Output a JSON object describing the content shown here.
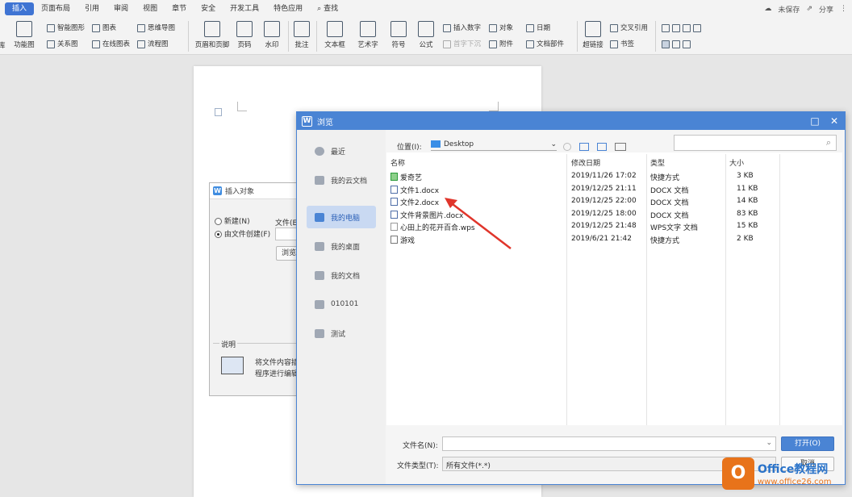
{
  "menubar": {
    "tabs": [
      "插入",
      "页面布局",
      "引用",
      "审阅",
      "视图",
      "章节",
      "安全",
      "开发工具",
      "特色应用",
      "查找"
    ],
    "right": {
      "unsaved": "未保存",
      "share": "分享"
    }
  },
  "ribbon": {
    "left_cut": [
      "库",
      "功能图"
    ],
    "col2": [
      "智能图形",
      "关系图"
    ],
    "col3": [
      "图表",
      "在线图表"
    ],
    "col4": [
      "思维导图",
      "流程图"
    ],
    "big": [
      "页眉和页脚",
      "页码",
      "水印",
      "批注",
      "文本框",
      "艺术字",
      "符号",
      "公式"
    ],
    "col5": [
      "插入数字",
      "首字下沉"
    ],
    "col6": [
      "对象",
      "附件"
    ],
    "col7": [
      "日期",
      "文档部件"
    ],
    "big2": [
      "超链接"
    ],
    "col8": [
      "交叉引用",
      "书签"
    ]
  },
  "insert_dialog": {
    "title": "插入对象",
    "radio_new": "新建(N)",
    "radio_from_file": "由文件创建(F)",
    "file_label": "文件(E",
    "browse_btn": "浏览",
    "desc_label": "说明",
    "desc_line1": "将文件内容插",
    "desc_line2": "程序进行编辑"
  },
  "browse_dialog": {
    "title": "浏览",
    "location_label": "位置(I):",
    "location_value": "Desktop",
    "sidebar": [
      "最近",
      "我的云文档",
      "我的电脑",
      "我的桌面",
      "我的文档",
      "010101",
      "测试"
    ],
    "columns": [
      "名称",
      "修改日期",
      "类型",
      "大小"
    ],
    "files": [
      {
        "name": "爱奇艺",
        "date": "2019/11/26 17:02",
        "type": "快捷方式",
        "size": "3 KB"
      },
      {
        "name": "文件1.docx",
        "date": "2019/12/25 21:11",
        "type": "DOCX 文档",
        "size": "11 KB"
      },
      {
        "name": "文件2.docx",
        "date": "2019/12/25 22:00",
        "type": "DOCX 文档",
        "size": "14 KB"
      },
      {
        "name": "文件背景图片.docx",
        "date": "2019/12/25 18:00",
        "type": "DOCX 文档",
        "size": "83 KB"
      },
      {
        "name": "心田上的花开百合.wps",
        "date": "2019/12/25 21:48",
        "type": "WPS文字 文档",
        "size": "15 KB"
      },
      {
        "name": "游戏",
        "date": "2019/6/21 21:42",
        "type": "快捷方式",
        "size": "2 KB"
      }
    ],
    "filename_label": "文件名(N):",
    "filetype_label": "文件类型(T):",
    "filetype_value": "所有文件(*.*)",
    "open_btn": "打开(O)",
    "cancel_btn": "取消"
  },
  "watermark": {
    "brand": "Office教程网",
    "url": "www.office26.com"
  }
}
